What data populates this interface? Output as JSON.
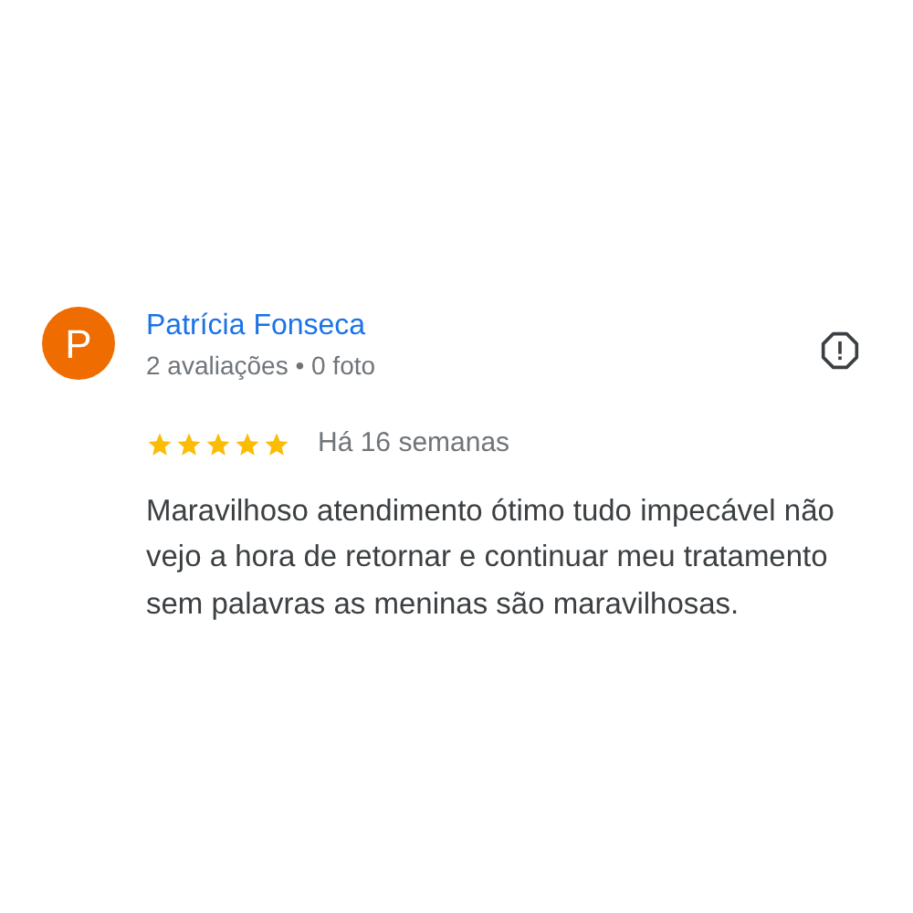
{
  "review": {
    "avatar_letter": "P",
    "author": "Patrícia Fonseca",
    "stats": "2 avaliações • 0 foto",
    "stars": 5,
    "time": "Há 16 semanas",
    "text": "Maravilhoso atendimento ótimo tudo impecável não vejo a hora de retornar e continuar meu tratamento sem palavras as meninas são maravilhosas."
  }
}
